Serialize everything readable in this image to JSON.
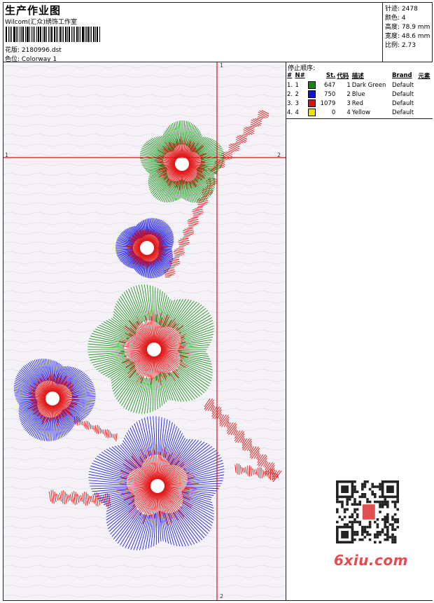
{
  "header": {
    "title": "生产作业图",
    "company": "Wilcom(汇众)绣饰工作室",
    "design_label": "花版: ",
    "design_file": "2180996.dst",
    "colorway_label": "色位: ",
    "colorway": "Colorway 1"
  },
  "stats": [
    {
      "label": "针迹: ",
      "value": "2478"
    },
    {
      "label": "颜色: ",
      "value": "4"
    },
    {
      "label": "高度: ",
      "value": "78.9 mm"
    },
    {
      "label": "宽度: ",
      "value": "48.6 mm"
    },
    {
      "label": "比例: ",
      "value": "2.73"
    }
  ],
  "stop_sequence": {
    "title": "停止顺序:",
    "columns": [
      "#",
      "N#",
      "St.",
      "代码",
      "描述",
      "Brand",
      "元素"
    ],
    "rows": [
      {
        "idx": "1.",
        "n": "1",
        "color": "#0a8a0a",
        "st": "647",
        "code": "1",
        "desc": "Dark Green",
        "brand": "Default"
      },
      {
        "idx": "2.",
        "n": "2",
        "color": "#1010e0",
        "st": "750",
        "code": "2",
        "desc": "Blue",
        "brand": "Default"
      },
      {
        "idx": "3.",
        "n": "3",
        "color": "#e01010",
        "st": "1079",
        "code": "3",
        "desc": "Red",
        "brand": "Default"
      },
      {
        "idx": "4.",
        "n": "4",
        "color": "#f0e000",
        "st": "0",
        "code": "4",
        "desc": "Yellow",
        "brand": "Default"
      }
    ]
  },
  "markers": {
    "v_top": "1",
    "v_bottom": "2",
    "h_left": "1",
    "h_right": "2"
  },
  "watermark": "6xiu.com",
  "colors": {
    "green": "#0a8a0a",
    "blue": "#1010e0",
    "red": "#e01010",
    "guide": "#e01010"
  }
}
